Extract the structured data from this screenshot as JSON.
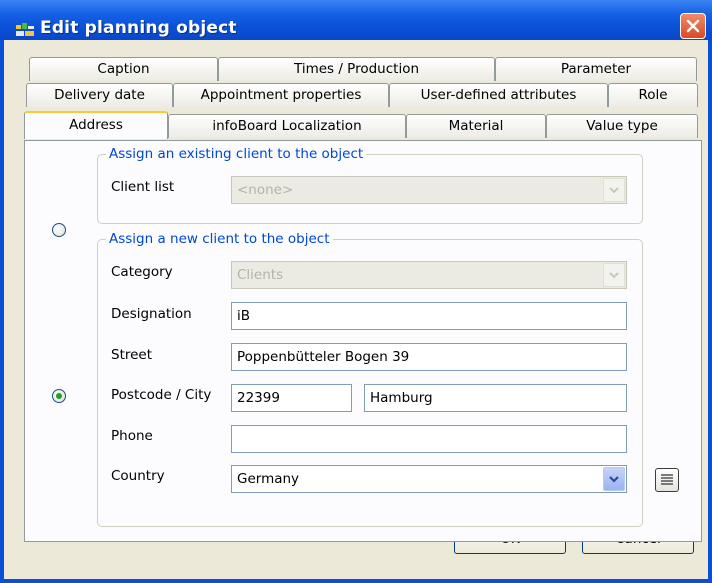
{
  "window": {
    "title": "Edit planning object"
  },
  "tabs": {
    "row1": [
      "Caption",
      "Times / Production",
      "Parameter"
    ],
    "row2": [
      "Delivery date",
      "Appointment properties",
      "User-defined attributes",
      "Role"
    ],
    "row3": [
      "Address",
      "infoBoard Localization",
      "Material",
      "Value type"
    ],
    "active": "Address"
  },
  "existing_client": {
    "legend": "Assign an existing client to the object",
    "client_list_label": "Client list",
    "client_list_value": "<none>",
    "selected": false
  },
  "new_client": {
    "legend": "Assign a new client to the object",
    "selected": true,
    "category_label": "Category",
    "category_value": "Clients",
    "designation_label": "Designation",
    "designation_value": "iB",
    "street_label": "Street",
    "street_value": "Poppenbütteler Bogen 39",
    "postcode_city_label": "Postcode / City",
    "postcode_value": "22399",
    "city_value": "Hamburg",
    "phone_label": "Phone",
    "phone_value": "",
    "country_label": "Country",
    "country_value": "Germany"
  },
  "buttons": {
    "ok": "OK",
    "cancel": "Cancel"
  },
  "colors": {
    "title_bar": "#0a50d6",
    "legend_text": "#0046d5",
    "dialog_bg": "#ece9d8",
    "close_button": "#d94a26"
  }
}
